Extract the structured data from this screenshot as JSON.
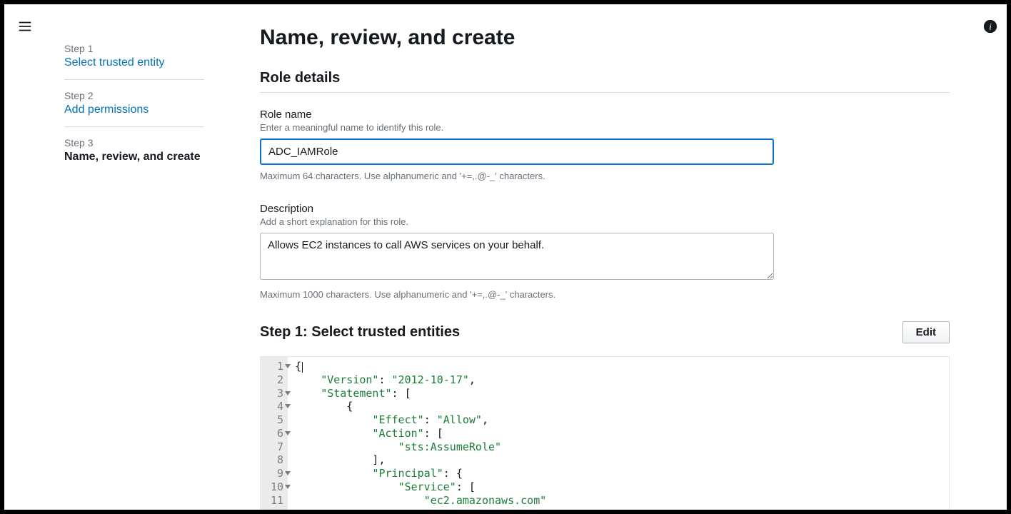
{
  "breadcrumb": {
    "sep": "›"
  },
  "header": {
    "title": "Name, review, and create"
  },
  "steps": [
    {
      "label": "Step 1",
      "title": "Select trusted entity",
      "link": true
    },
    {
      "label": "Step 2",
      "title": "Add permissions",
      "link": true
    },
    {
      "label": "Step 3",
      "title": "Name, review, and create",
      "link": false
    }
  ],
  "role_details": {
    "heading": "Role details",
    "name_label": "Role name",
    "name_hint": "Enter a meaningful name to identify this role.",
    "name_value": "ADC_IAMRole",
    "name_constraint": "Maximum 64 characters. Use alphanumeric and '+=,.@-_' characters.",
    "desc_label": "Description",
    "desc_hint": "Add a short explanation for this role.",
    "desc_value": "Allows EC2 instances to call AWS services on your behalf.",
    "desc_constraint": "Maximum 1000 characters. Use alphanumeric and '+=,.@-_' characters."
  },
  "trusted": {
    "heading": "Step 1: Select trusted entities",
    "edit": "Edit",
    "policy": {
      "Version": "2012-10-17",
      "Statement": [
        {
          "Effect": "Allow",
          "Action": [
            "sts:AssumeRole"
          ],
          "Principal": {
            "Service": [
              "ec2.amazonaws.com"
            ]
          }
        }
      ]
    },
    "visible_lines": 11
  }
}
